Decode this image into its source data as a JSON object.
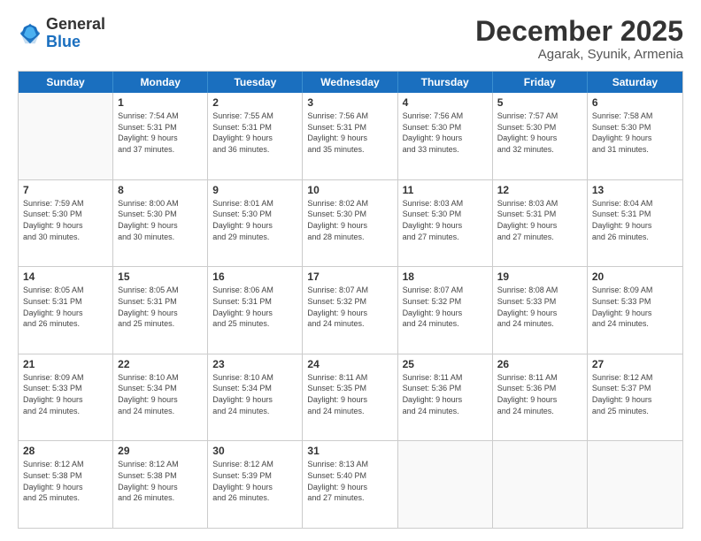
{
  "header": {
    "logo_line1": "General",
    "logo_line2": "Blue",
    "title": "December 2025",
    "subtitle": "Agarak, Syunik, Armenia"
  },
  "days_of_week": [
    "Sunday",
    "Monday",
    "Tuesday",
    "Wednesday",
    "Thursday",
    "Friday",
    "Saturday"
  ],
  "weeks": [
    [
      {
        "day": "",
        "info": ""
      },
      {
        "day": "1",
        "info": "Sunrise: 7:54 AM\nSunset: 5:31 PM\nDaylight: 9 hours\nand 37 minutes."
      },
      {
        "day": "2",
        "info": "Sunrise: 7:55 AM\nSunset: 5:31 PM\nDaylight: 9 hours\nand 36 minutes."
      },
      {
        "day": "3",
        "info": "Sunrise: 7:56 AM\nSunset: 5:31 PM\nDaylight: 9 hours\nand 35 minutes."
      },
      {
        "day": "4",
        "info": "Sunrise: 7:56 AM\nSunset: 5:30 PM\nDaylight: 9 hours\nand 33 minutes."
      },
      {
        "day": "5",
        "info": "Sunrise: 7:57 AM\nSunset: 5:30 PM\nDaylight: 9 hours\nand 32 minutes."
      },
      {
        "day": "6",
        "info": "Sunrise: 7:58 AM\nSunset: 5:30 PM\nDaylight: 9 hours\nand 31 minutes."
      }
    ],
    [
      {
        "day": "7",
        "info": "Sunrise: 7:59 AM\nSunset: 5:30 PM\nDaylight: 9 hours\nand 30 minutes."
      },
      {
        "day": "8",
        "info": "Sunrise: 8:00 AM\nSunset: 5:30 PM\nDaylight: 9 hours\nand 30 minutes."
      },
      {
        "day": "9",
        "info": "Sunrise: 8:01 AM\nSunset: 5:30 PM\nDaylight: 9 hours\nand 29 minutes."
      },
      {
        "day": "10",
        "info": "Sunrise: 8:02 AM\nSunset: 5:30 PM\nDaylight: 9 hours\nand 28 minutes."
      },
      {
        "day": "11",
        "info": "Sunrise: 8:03 AM\nSunset: 5:30 PM\nDaylight: 9 hours\nand 27 minutes."
      },
      {
        "day": "12",
        "info": "Sunrise: 8:03 AM\nSunset: 5:31 PM\nDaylight: 9 hours\nand 27 minutes."
      },
      {
        "day": "13",
        "info": "Sunrise: 8:04 AM\nSunset: 5:31 PM\nDaylight: 9 hours\nand 26 minutes."
      }
    ],
    [
      {
        "day": "14",
        "info": "Sunrise: 8:05 AM\nSunset: 5:31 PM\nDaylight: 9 hours\nand 26 minutes."
      },
      {
        "day": "15",
        "info": "Sunrise: 8:05 AM\nSunset: 5:31 PM\nDaylight: 9 hours\nand 25 minutes."
      },
      {
        "day": "16",
        "info": "Sunrise: 8:06 AM\nSunset: 5:31 PM\nDaylight: 9 hours\nand 25 minutes."
      },
      {
        "day": "17",
        "info": "Sunrise: 8:07 AM\nSunset: 5:32 PM\nDaylight: 9 hours\nand 24 minutes."
      },
      {
        "day": "18",
        "info": "Sunrise: 8:07 AM\nSunset: 5:32 PM\nDaylight: 9 hours\nand 24 minutes."
      },
      {
        "day": "19",
        "info": "Sunrise: 8:08 AM\nSunset: 5:33 PM\nDaylight: 9 hours\nand 24 minutes."
      },
      {
        "day": "20",
        "info": "Sunrise: 8:09 AM\nSunset: 5:33 PM\nDaylight: 9 hours\nand 24 minutes."
      }
    ],
    [
      {
        "day": "21",
        "info": "Sunrise: 8:09 AM\nSunset: 5:33 PM\nDaylight: 9 hours\nand 24 minutes."
      },
      {
        "day": "22",
        "info": "Sunrise: 8:10 AM\nSunset: 5:34 PM\nDaylight: 9 hours\nand 24 minutes."
      },
      {
        "day": "23",
        "info": "Sunrise: 8:10 AM\nSunset: 5:34 PM\nDaylight: 9 hours\nand 24 minutes."
      },
      {
        "day": "24",
        "info": "Sunrise: 8:11 AM\nSunset: 5:35 PM\nDaylight: 9 hours\nand 24 minutes."
      },
      {
        "day": "25",
        "info": "Sunrise: 8:11 AM\nSunset: 5:36 PM\nDaylight: 9 hours\nand 24 minutes."
      },
      {
        "day": "26",
        "info": "Sunrise: 8:11 AM\nSunset: 5:36 PM\nDaylight: 9 hours\nand 24 minutes."
      },
      {
        "day": "27",
        "info": "Sunrise: 8:12 AM\nSunset: 5:37 PM\nDaylight: 9 hours\nand 25 minutes."
      }
    ],
    [
      {
        "day": "28",
        "info": "Sunrise: 8:12 AM\nSunset: 5:38 PM\nDaylight: 9 hours\nand 25 minutes."
      },
      {
        "day": "29",
        "info": "Sunrise: 8:12 AM\nSunset: 5:38 PM\nDaylight: 9 hours\nand 26 minutes."
      },
      {
        "day": "30",
        "info": "Sunrise: 8:12 AM\nSunset: 5:39 PM\nDaylight: 9 hours\nand 26 minutes."
      },
      {
        "day": "31",
        "info": "Sunrise: 8:13 AM\nSunset: 5:40 PM\nDaylight: 9 hours\nand 27 minutes."
      },
      {
        "day": "",
        "info": ""
      },
      {
        "day": "",
        "info": ""
      },
      {
        "day": "",
        "info": ""
      }
    ]
  ]
}
